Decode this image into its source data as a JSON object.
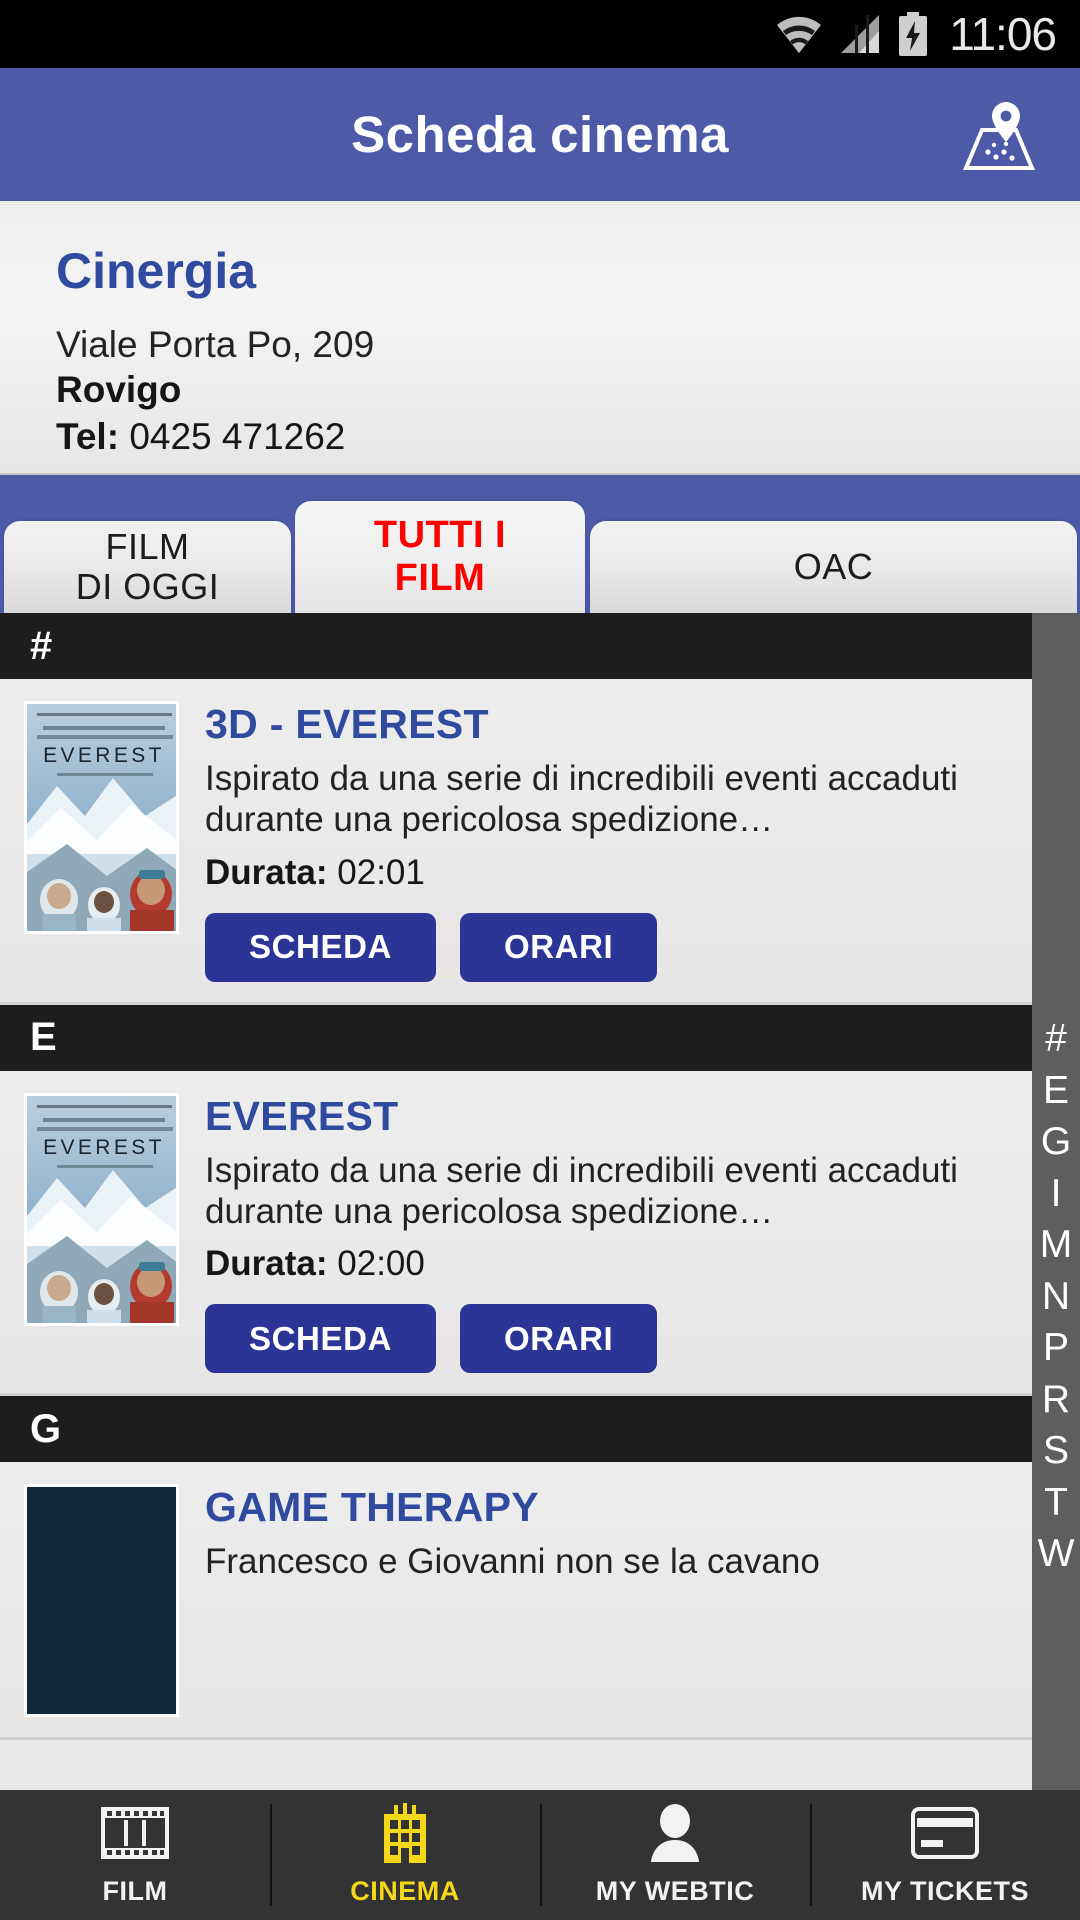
{
  "status_bar": {
    "time": "11:06",
    "icons": [
      "wifi-icon",
      "cellular-signal-icon",
      "battery-charging-icon"
    ]
  },
  "app_bar": {
    "title": "Scheda cinema",
    "map_button_icon": "map-pin-icon",
    "background_color": "#4c5aa8"
  },
  "cinema": {
    "name": "Cinergia",
    "address": "Viale Porta Po, 209",
    "city": "Rovigo",
    "phone_label": "Tel:",
    "phone_number": "0425 471262",
    "name_color": "#2f4a9e"
  },
  "tabs": {
    "active_index": 1,
    "active_color": "#ff0000",
    "items": [
      {
        "line1": "FILM",
        "line2": "DI OGGI"
      },
      {
        "line1": "TUTTI I",
        "line2": "FILM"
      },
      {
        "line1": "OAC",
        "line2": ""
      }
    ]
  },
  "alpha_index": {
    "letters": [
      "#",
      "E",
      "G",
      "I",
      "M",
      "N",
      "P",
      "R",
      "S",
      "T",
      "W"
    ],
    "background_color": "#5e5e5e"
  },
  "list": {
    "buttons": {
      "details": "SCHEDA",
      "showtimes": "ORARI"
    },
    "duration_label": "Durata:",
    "sections": [
      {
        "letter": "#",
        "movies": [
          {
            "title": "3D - EVEREST",
            "description": "Ispirato da una serie di incredibili eventi accaduti durante una pericolosa spedizione…",
            "duration": "02:01",
            "poster": "everest-poster"
          }
        ]
      },
      {
        "letter": "E",
        "movies": [
          {
            "title": "EVEREST",
            "description": "Ispirato da una serie di incredibili eventi accaduti durante una pericolosa spedizione…",
            "duration": "02:00",
            "poster": "everest-poster"
          }
        ]
      },
      {
        "letter": "G",
        "movies": [
          {
            "title": "GAME THERAPY",
            "description": "Francesco e Giovanni non se la cavano",
            "duration": "",
            "poster": "game-therapy-poster"
          }
        ]
      }
    ]
  },
  "bottom_nav": {
    "active_index": 1,
    "active_color": "#f5d817",
    "items": [
      {
        "label": "FILM",
        "icon": "filmstrip-icon"
      },
      {
        "label": "CINEMA",
        "icon": "cinema-building-icon"
      },
      {
        "label": "MY WEBTIC",
        "icon": "person-icon"
      },
      {
        "label": "MY TICKETS",
        "icon": "credit-card-icon"
      }
    ]
  }
}
